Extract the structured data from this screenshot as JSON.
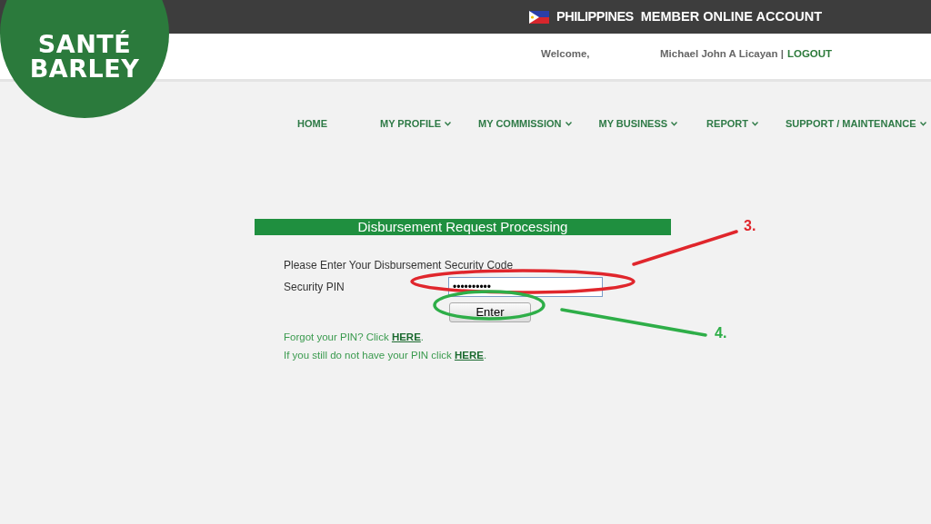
{
  "top_bar": {
    "country": "PHILIPPINES",
    "title": "MEMBER ONLINE ACCOUNT"
  },
  "logo": {
    "line_1": "SANTÉ",
    "line_2": "BARLEY"
  },
  "header": {
    "welcome": "Welcome,",
    "user": "Michael John A Licayan |",
    "logout": "LOGOUT"
  },
  "nav": [
    {
      "label": "HOME",
      "dropdown": false
    },
    {
      "label": "MY PROFILE",
      "dropdown": true
    },
    {
      "label": "MY COMMISSION",
      "dropdown": true
    },
    {
      "label": "MY BUSINESS",
      "dropdown": true
    },
    {
      "label": "REPORT",
      "dropdown": true
    },
    {
      "label": "SUPPORT / MAINTENANCE",
      "dropdown": true
    }
  ],
  "form": {
    "title": "Disbursement Request Processing",
    "instruction": "Please Enter Your Disbursement Security Code",
    "pin_label": "Security PIN",
    "pin_value": "••••••••••",
    "button": "Enter",
    "links": [
      {
        "before": "Forgot your PIN? Click ",
        "link": "HERE",
        "after": "."
      },
      {
        "before": "If you still do not have your PIN click ",
        "link": "HERE",
        "after": "."
      }
    ]
  },
  "annotations": [
    {
      "label": "3.",
      "color": "#e0262c"
    },
    {
      "label": "4.",
      "color": "#2eae48"
    }
  ]
}
